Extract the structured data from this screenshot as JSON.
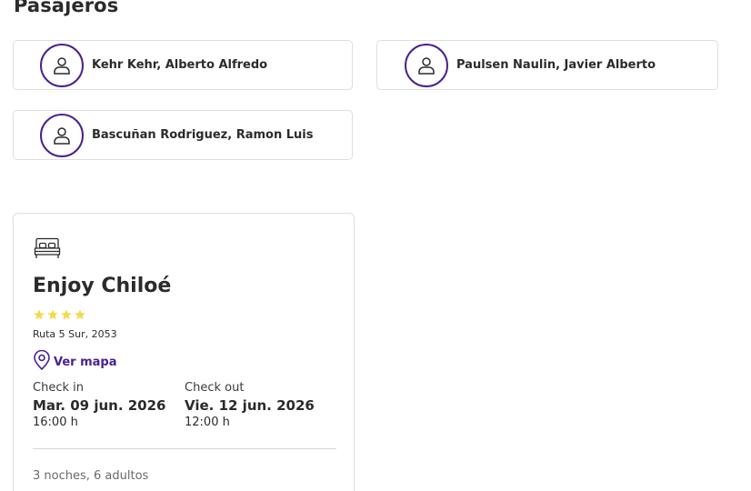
{
  "passengers_section": {
    "title": "Pasajeros",
    "passengers": [
      {
        "name": "Kehr Kehr, Alberto Alfredo"
      },
      {
        "name": "Paulsen Naulin, Javier Alberto"
      },
      {
        "name": "Bascuñan Rodriguez, Ramon Luis"
      }
    ]
  },
  "hotel": {
    "icon": "bed-icon",
    "name": "Enjoy Chiloé",
    "stars": 4,
    "star_color": "#f5d94a",
    "address": "Ruta 5 Sur, 2053",
    "map_link": {
      "icon": "map-pin-icon",
      "label": "Ver mapa"
    },
    "check_in": {
      "label": "Check in",
      "date": "Mar. 09 jun. 2026",
      "time": "16:00 h"
    },
    "check_out": {
      "label": "Check out",
      "date": "Vie. 12 jun. 2026",
      "time": "12:00 h"
    },
    "summary": "3 noches, 6 adultos"
  },
  "colors": {
    "accent": "#4a2191",
    "card_border": "#dedede",
    "text": "#2b2b2b",
    "muted_text": "#6a6a6a"
  }
}
